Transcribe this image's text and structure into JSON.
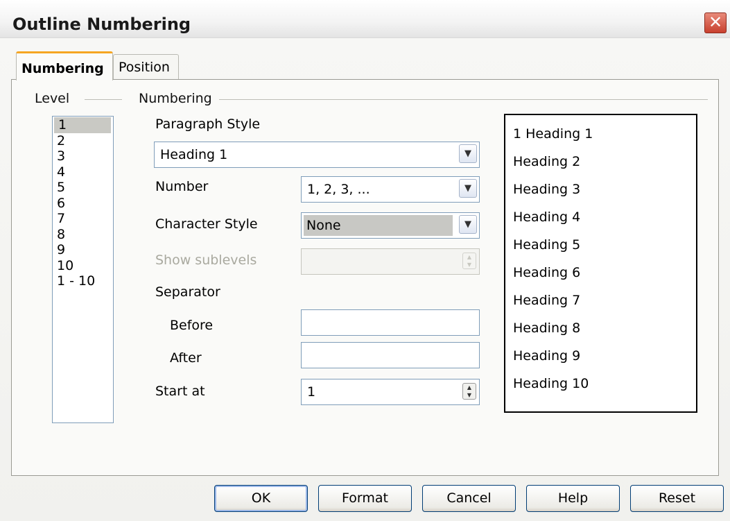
{
  "window": {
    "title": "Outline Numbering",
    "close_glyph": "✕"
  },
  "tabs": [
    {
      "label": "Numbering",
      "active": true
    },
    {
      "label": "Position",
      "active": false
    }
  ],
  "level": {
    "group_label": "Level",
    "items": [
      "1",
      "2",
      "3",
      "4",
      "5",
      "6",
      "7",
      "8",
      "9",
      "10",
      "1 - 10"
    ],
    "selected": "1"
  },
  "numbering": {
    "group_label": "Numbering",
    "paragraph_style": {
      "label": "Paragraph Style",
      "value": "Heading 1"
    },
    "number": {
      "label": "Number",
      "value": "1, 2, 3, ..."
    },
    "character_style": {
      "label": "Character Style",
      "value": "None"
    },
    "show_sublevels": {
      "label": "Show sublevels",
      "value": ""
    },
    "separator": {
      "label": "Separator",
      "before_label": "Before",
      "before_value": "",
      "after_label": "After",
      "after_value": ""
    },
    "start_at": {
      "label": "Start at",
      "value": "1"
    }
  },
  "preview": {
    "lines": [
      "1 Heading 1",
      "Heading 2",
      "Heading 3",
      "Heading 4",
      "Heading 5",
      "Heading 6",
      "Heading 7",
      "Heading 8",
      "Heading 9",
      "Heading 10"
    ]
  },
  "buttons": {
    "ok": "OK",
    "format": "Format",
    "cancel": "Cancel",
    "help": "Help",
    "reset": "Reset"
  },
  "icons": {
    "dropdown": "chevron-down-icon",
    "spinner": "spin-arrows-icon",
    "close": "close-icon"
  },
  "colors": {
    "tab_accent": "#f5a623",
    "close_button": "#c8402e",
    "field_border": "#7f9db9",
    "disabled_text": "#a9a99f"
  }
}
